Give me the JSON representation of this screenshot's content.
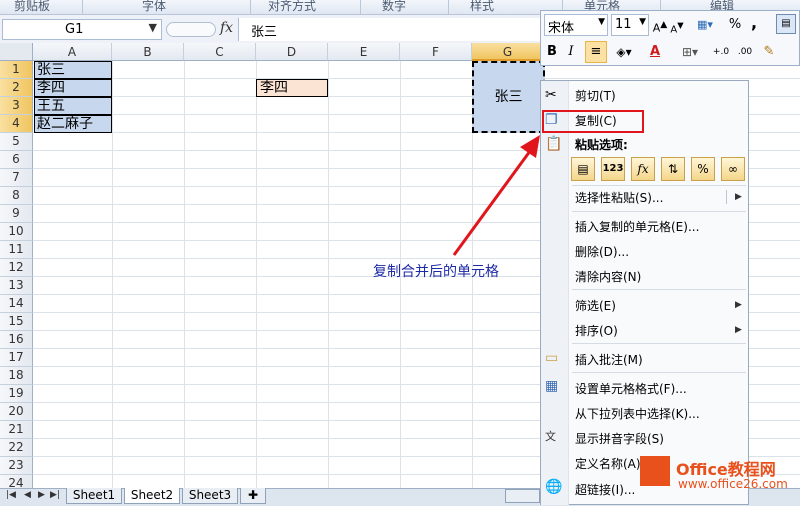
{
  "ribbon": {
    "groups": [
      "剪贴板",
      "字体",
      "对齐方式",
      "数字",
      "样式",
      "单元格",
      "编辑"
    ]
  },
  "formula_bar": {
    "name_box": "G1",
    "fx": "fx",
    "content": "张三"
  },
  "columns": [
    "A",
    "B",
    "C",
    "D",
    "E",
    "F",
    "G"
  ],
  "rows": [
    "1",
    "2",
    "3",
    "4",
    "5",
    "6",
    "7",
    "8",
    "9",
    "10",
    "11",
    "12",
    "13",
    "14",
    "15",
    "16",
    "17",
    "18",
    "19",
    "20",
    "21",
    "22",
    "23",
    "24"
  ],
  "cells": {
    "A1": "张三",
    "A2": "李四",
    "A3": "王五",
    "A4": "赵二麻子",
    "D2": "李四",
    "G1": "张三"
  },
  "annotation": "复制合并后的单元格",
  "mini_toolbar": {
    "font_name": "宋体",
    "font_size": "11",
    "bold": "B",
    "italic": "I",
    "percent": "%",
    "comma": ","
  },
  "context_menu": {
    "cut": "剪切(T)",
    "copy": "复制(C)",
    "paste_options": "粘贴选项:",
    "paste_special": "选择性粘贴(S)...",
    "insert_copied": "插入复制的单元格(E)...",
    "delete": "删除(D)...",
    "clear": "清除内容(N)",
    "filter": "筛选(E)",
    "sort": "排序(O)",
    "insert_comment": "插入批注(M)",
    "format_cells": "设置单元格格式(F)...",
    "pick_list": "从下拉列表中选择(K)...",
    "phonetic": "显示拼音字段(S)",
    "define_name": "定义名称(A)...",
    "hyperlink": "超链接(I)..."
  },
  "sheets": [
    "Sheet1",
    "Sheet2",
    "Sheet3"
  ],
  "watermark": {
    "title": "Office教程网",
    "url": "www.office26.com"
  }
}
